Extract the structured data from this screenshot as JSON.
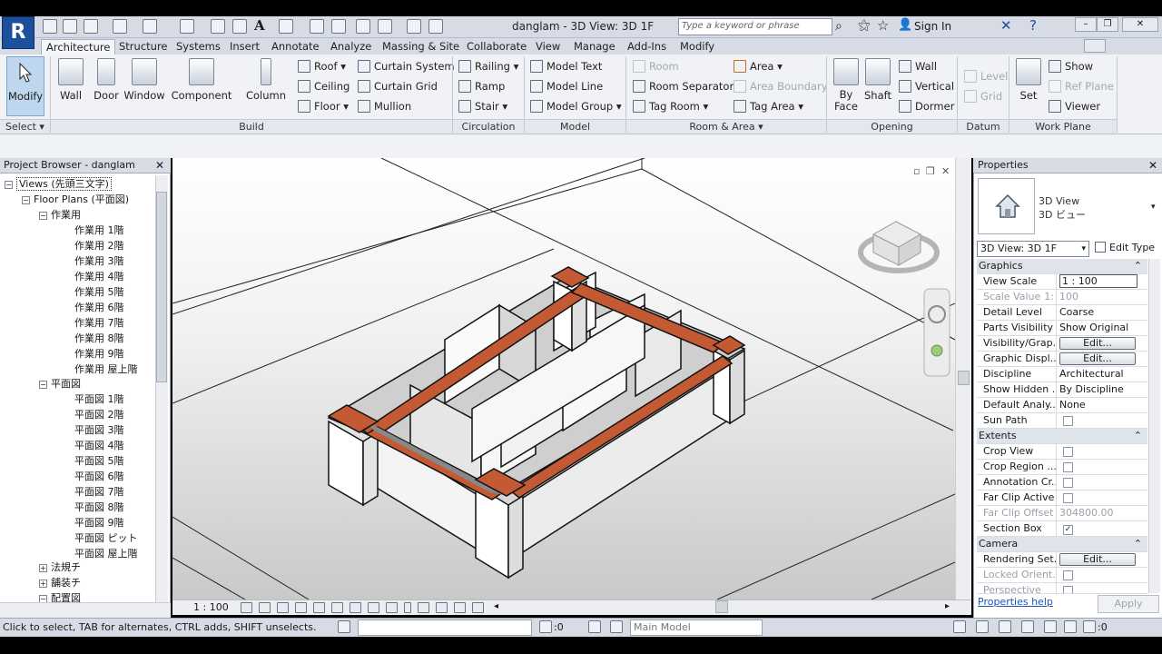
{
  "app": {
    "logo_letter": "R",
    "title": "danglam - 3D View: 3D 1F",
    "search_placeholder": "Type a keyword or phrase",
    "sign_in": "Sign In"
  },
  "ribbon": {
    "tabs": [
      "Architecture",
      "Structure",
      "Systems",
      "Insert",
      "Annotate",
      "Analyze",
      "Massing & Site",
      "Collaborate",
      "View",
      "Manage",
      "Add-Ins",
      "Modify"
    ],
    "active_tab": "Architecture",
    "modify": "Modify",
    "select_label": "Select",
    "build": {
      "label": "Build",
      "wall": "Wall",
      "door": "Door",
      "window": "Window",
      "component": "Component",
      "column": "Column",
      "roof": "Roof",
      "ceiling": "Ceiling",
      "floor": "Floor",
      "curtain_system": "Curtain System",
      "curtain_grid": "Curtain Grid",
      "mullion": "Mullion"
    },
    "circulation": {
      "label": "Circulation",
      "railing": "Railing",
      "ramp": "Ramp",
      "stair": "Stair"
    },
    "model": {
      "label": "Model",
      "model_text": "Model Text",
      "model_line": "Model Line",
      "model_group": "Model Group"
    },
    "room_area": {
      "label": "Room & Area",
      "room": "Room",
      "room_separator": "Room Separator",
      "tag_room": "Tag Room",
      "area": "Area",
      "area_boundary": "Area Boundary",
      "tag_area": "Tag Area"
    },
    "opening": {
      "label": "Opening",
      "by_face_1": "By",
      "by_face_2": "Face",
      "shaft": "Shaft",
      "wall": "Wall",
      "vertical": "Vertical",
      "dormer": "Dormer"
    },
    "datum": {
      "label": "Datum",
      "level": "Level",
      "grid": "Grid"
    },
    "work_plane": {
      "label": "Work Plane",
      "set": "Set",
      "show": "Show",
      "ref_plane": "Ref Plane",
      "viewer": "Viewer"
    }
  },
  "project_browser": {
    "title": "Project Browser - danglam",
    "views_root": "Views (先頭三文字)",
    "floor_plans": "Floor Plans (平面図)",
    "group1": "作業用",
    "group1_items": [
      "作業用 1階",
      "作業用 2階",
      "作業用 3階",
      "作業用 4階",
      "作業用 5階",
      "作業用 6階",
      "作業用 7階",
      "作業用 8階",
      "作業用 9階",
      "作業用 屋上階"
    ],
    "group2": "平面図",
    "group2_items": [
      "平面図 1階",
      "平面図 2階",
      "平面図 3階",
      "平面図 4階",
      "平面図 5階",
      "平面図 6階",
      "平面図 7階",
      "平面図 8階",
      "平面図 9階",
      "平面図 ピット",
      "平面図 屋上階"
    ],
    "more_groups": [
      "法規チ",
      "舗装チ",
      "配置図"
    ]
  },
  "viewport": {
    "scale": "1 : 100"
  },
  "properties": {
    "title": "Properties",
    "type_line1": "3D View",
    "type_line2": "3D ビュー",
    "view_selector": "3D View: 3D 1F",
    "edit_type": "Edit Type",
    "groups": {
      "graphics": "Graphics",
      "extents": "Extents",
      "camera": "Camera"
    },
    "rows": {
      "view_scale_k": "View Scale",
      "view_scale_v": "1 : 100",
      "scale_value_k": "Scale Value",
      "scale_value_mid": "1:",
      "scale_value_v": "100",
      "detail_level_k": "Detail Level",
      "detail_level_v": "Coarse",
      "parts_vis_k": "Parts Visibility",
      "parts_vis_v": "Show Original",
      "vis_graph_k": "Visibility/Grap...",
      "edit": "Edit...",
      "graphic_disp_k": "Graphic Displ...",
      "discipline_k": "Discipline",
      "discipline_v": "Architectural",
      "show_hidden_k": "Show Hidden ...",
      "show_hidden_v": "By Discipline",
      "default_analy_k": "Default Analy...",
      "default_analy_v": "None",
      "sun_path_k": "Sun Path",
      "crop_view_k": "Crop View",
      "crop_region_k": "Crop Region ...",
      "annotation_cr_k": "Annotation Cr...",
      "far_clip_active_k": "Far Clip Active",
      "far_clip_offset_k": "Far Clip Offset",
      "far_clip_offset_v": "304800.00",
      "section_box_k": "Section Box",
      "rendering_set_k": "Rendering Set...",
      "locked_orient_k": "Locked Orient...",
      "perspective_k": "Perspective"
    },
    "help": "Properties help",
    "apply": "Apply"
  },
  "status": {
    "message": "Click to select, TAB for alternates, CTRL adds, SHIFT unselects.",
    "zero1": ":0",
    "model": "Main Model",
    "zero2": ":0"
  },
  "colors": {
    "accent": "#1c4f9c",
    "beam": "#c45a34",
    "selected_tool": "#bfd6ef"
  }
}
